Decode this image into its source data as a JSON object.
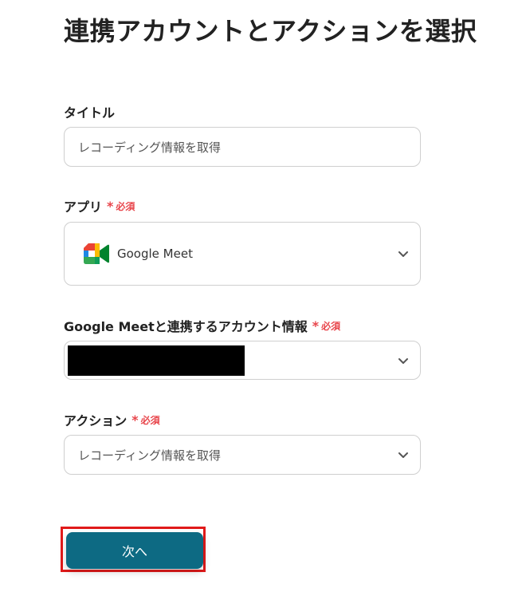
{
  "page": {
    "title": "連携アカウントとアクションを選択"
  },
  "required_mark": {
    "star": "*",
    "text": "必須"
  },
  "fields": {
    "title": {
      "label": "タイトル",
      "value": "レコーディング情報を取得"
    },
    "app": {
      "label": "アプリ",
      "required": true,
      "selected": "Google Meet",
      "icon": "google-meet-icon"
    },
    "account": {
      "label": "Google Meetと連携するアカウント情報",
      "required": true,
      "selected": "[redacted]"
    },
    "action": {
      "label": "アクション",
      "required": true,
      "selected": "レコーディング情報を取得"
    }
  },
  "buttons": {
    "next_label": "次へ"
  },
  "colors": {
    "primary": "#0d6a83",
    "required": "#e8454b",
    "highlight": "#e11a1a",
    "border": "#cfcfcf"
  }
}
